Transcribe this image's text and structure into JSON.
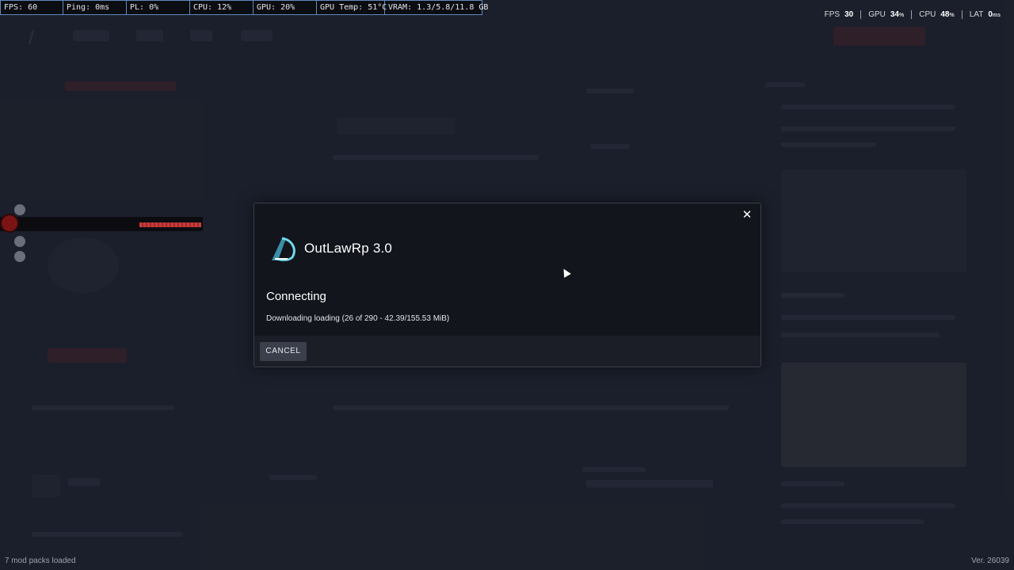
{
  "perf_bar": {
    "fps": "FPS: 60",
    "ping": "Ping: 0ms",
    "pl": "PL: 0%",
    "cpu": "CPU: 12%",
    "gpu": "GPU: 20%",
    "gpu_temp": "GPU Temp: 51°C",
    "vram": "VRAM: 1.3/5.8/11.8 GB"
  },
  "top_stats": {
    "fps_label": "FPS",
    "fps_value": "30",
    "gpu_label": "GPU",
    "gpu_value": "34",
    "gpu_unit": "%",
    "cpu_label": "CPU",
    "cpu_value": "48",
    "cpu_unit": "%",
    "lat_label": "LAT",
    "lat_value": "0",
    "lat_unit": "ms"
  },
  "modal": {
    "server_name": "OutLawRp 3.0",
    "status_title": "Connecting",
    "status_detail": "Downloading loading (26 of 290 - 42.39/155.53 MiB)",
    "cancel_label": "CANCEL",
    "close_glyph": "✕"
  },
  "footer": {
    "mod_packs": "7 mod packs loaded",
    "version": "Ver. 26039"
  },
  "colors": {
    "accent_cyan": "#5fd0e6",
    "perf_border": "#5f8bbd",
    "modal_bg": "#12151c"
  }
}
